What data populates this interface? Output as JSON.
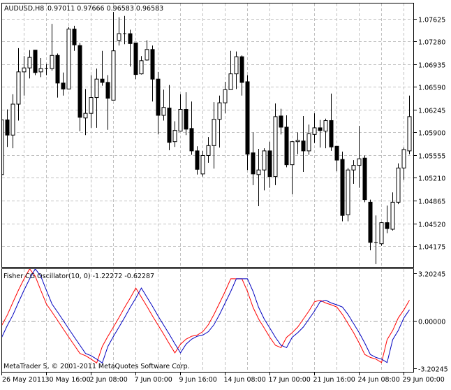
{
  "header": {
    "symbol": "AUDUSD,H8",
    "ohlc_readout": "0.97011 0.97666 0.96583 0.96583"
  },
  "indicator": {
    "label": "Fisher CG Oscillator(10, 0) -1.22272 -0.62287"
  },
  "copyright": "MetaTrader 5, © 2001-2011 MetaQuotes Software Corp.",
  "colors": {
    "background": "#ffffff",
    "grid": "#c0c0c0",
    "candle": "#000000",
    "fisher_line": "#ff0000",
    "trigger_line": "#0000c0"
  },
  "chart_data": [
    {
      "type": "candlestick",
      "timeframe": "H8",
      "grid": true,
      "ylim": [
        1.039,
        1.078
      ],
      "ytick_labels": [
        "1.07625",
        "1.07280",
        "1.06935",
        "1.06590",
        "1.06245",
        "1.05900",
        "1.05555",
        "1.05210",
        "1.04865",
        "1.04520",
        "1.04175"
      ],
      "ohlc": [
        [
          1.0526,
          1.0609,
          1.0526,
          1.0609
        ],
        [
          1.0609,
          1.0625,
          1.0568,
          1.0586
        ],
        [
          1.0586,
          1.0648,
          1.0566,
          1.0633
        ],
        [
          1.0633,
          1.0718,
          1.0608,
          1.0682
        ],
        [
          1.0682,
          1.0706,
          1.0646,
          1.0688
        ],
        [
          1.0688,
          1.0715,
          1.0672,
          1.0704
        ],
        [
          1.0715,
          1.0715,
          1.0677,
          1.0681
        ],
        [
          1.0682,
          1.0703,
          1.0674,
          1.0687
        ],
        [
          1.0687,
          1.0694,
          1.0677,
          1.0687
        ],
        [
          1.0687,
          1.0755,
          1.0684,
          1.0707
        ],
        [
          1.0707,
          1.071,
          1.0643,
          1.0665
        ],
        [
          1.0665,
          1.0681,
          1.0646,
          1.0656
        ],
        [
          1.0656,
          1.075,
          1.0656,
          1.0747
        ],
        [
          1.0747,
          1.0752,
          1.0714,
          1.0723
        ],
        [
          1.0722,
          1.0726,
          1.0592,
          1.0613
        ],
        [
          1.0612,
          1.0656,
          1.0586,
          1.0619
        ],
        [
          1.0619,
          1.0677,
          1.0597,
          1.0643
        ],
        [
          1.0643,
          1.0687,
          1.0597,
          1.0671
        ],
        [
          1.0671,
          1.0714,
          1.0661,
          1.0666
        ],
        [
          1.0666,
          1.0677,
          1.0594,
          1.0642
        ],
        [
          1.0639,
          1.0773,
          1.0639,
          1.0714
        ],
        [
          1.073,
          1.0765,
          1.0722,
          1.074
        ],
        [
          1.074,
          1.0767,
          1.0724,
          1.074
        ],
        [
          1.074,
          1.0746,
          1.069,
          1.0725
        ],
        [
          1.0726,
          1.0726,
          1.0671,
          1.0678
        ],
        [
          1.0679,
          1.0706,
          1.0678,
          1.0699
        ],
        [
          1.07,
          1.073,
          1.0699,
          1.0716
        ],
        [
          1.0716,
          1.0722,
          1.0637,
          1.0671
        ],
        [
          1.0671,
          1.0682,
          1.0587,
          1.0616
        ],
        [
          1.0616,
          1.0655,
          1.0608,
          1.0628
        ],
        [
          1.0627,
          1.0662,
          1.0563,
          1.0575
        ],
        [
          1.0576,
          1.0607,
          1.0568,
          1.0593
        ],
        [
          1.0592,
          1.0648,
          1.0592,
          1.0625
        ],
        [
          1.0625,
          1.0651,
          1.0586,
          1.0595
        ],
        [
          1.0596,
          1.0637,
          1.0556,
          1.0562
        ],
        [
          1.0562,
          1.0569,
          1.0526,
          1.0534
        ],
        [
          1.0527,
          1.0562,
          1.0523,
          1.0555
        ],
        [
          1.0555,
          1.0583,
          1.0544,
          1.057
        ],
        [
          1.057,
          1.0636,
          1.0535,
          1.061
        ],
        [
          1.061,
          1.0646,
          1.0567,
          1.0635
        ],
        [
          1.0635,
          1.0667,
          1.0619,
          1.0655
        ],
        [
          1.0655,
          1.0714,
          1.0655,
          1.0679
        ],
        [
          1.0679,
          1.0713,
          1.0656,
          1.0705
        ],
        [
          1.0705,
          1.0707,
          1.0646,
          1.0666
        ],
        [
          1.0667,
          1.0677,
          1.0533,
          1.0557
        ],
        [
          1.0559,
          1.059,
          1.051,
          1.0527
        ],
        [
          1.0526,
          1.0565,
          1.0478,
          1.0533
        ],
        [
          1.0533,
          1.0566,
          1.0502,
          1.0562
        ],
        [
          1.0562,
          1.0576,
          1.0506,
          1.0523
        ],
        [
          1.0523,
          1.0634,
          1.051,
          1.0614
        ],
        [
          1.0615,
          1.0626,
          1.0587,
          1.0598
        ],
        [
          1.0598,
          1.0616,
          1.0537,
          1.0541
        ],
        [
          1.0541,
          1.0577,
          1.0496,
          1.0576
        ],
        [
          1.0576,
          1.059,
          1.0557,
          1.0578
        ],
        [
          1.0577,
          1.0615,
          1.053,
          1.0562
        ],
        [
          1.0562,
          1.0602,
          1.0556,
          1.0588
        ],
        [
          1.0587,
          1.0619,
          1.0574,
          1.0597
        ],
        [
          1.0597,
          1.0609,
          1.0567,
          1.0593
        ],
        [
          1.0592,
          1.0611,
          1.0566,
          1.0608
        ],
        [
          1.0608,
          1.0649,
          1.0562,
          1.0568
        ],
        [
          1.0569,
          1.0569,
          1.0531,
          1.0548
        ],
        [
          1.0549,
          1.0561,
          1.0455,
          1.0464
        ],
        [
          1.0465,
          1.0536,
          1.0455,
          1.0533
        ],
        [
          1.0533,
          1.0548,
          1.0512,
          1.054
        ],
        [
          1.054,
          1.06,
          1.0506,
          1.055
        ],
        [
          1.0551,
          1.0555,
          1.0484,
          1.0488
        ],
        [
          1.0484,
          1.0488,
          1.0411,
          1.0423
        ],
        [
          1.0423,
          1.0464,
          1.039,
          1.0423
        ],
        [
          1.0421,
          1.0454,
          1.0418,
          1.0453
        ],
        [
          1.0453,
          1.0479,
          1.0437,
          1.0444
        ],
        [
          1.0443,
          1.0499,
          1.0441,
          1.0484
        ],
        [
          1.0484,
          1.0543,
          1.0481,
          1.0536
        ],
        [
          1.0536,
          1.0567,
          1.0518,
          1.0564
        ],
        [
          1.0562,
          1.0646,
          1.0557,
          1.0614
        ]
      ]
    },
    {
      "type": "line",
      "title": "Fisher CG Oscillator(10, 0)",
      "ylim": [
        -3.20245,
        3.20245
      ],
      "ytick_labels": [
        "3.20245",
        "0.00000",
        "-3.20245"
      ],
      "grid": true,
      "series": [
        {
          "color": "#ff0000",
          "values": [
            -0.31,
            0.39,
            1.25,
            2.07,
            2.83,
            3.5,
            3.0,
            2.05,
            1.13,
            0.59,
            0.03,
            -0.54,
            -1.1,
            -1.65,
            -2.2,
            -2.35,
            -2.58,
            -2.84,
            -1.73,
            -1.05,
            -0.42,
            0.22,
            0.9,
            1.53,
            2.21,
            1.59,
            0.97,
            0.32,
            -0.29,
            -0.91,
            -1.55,
            -2.16,
            -1.58,
            -1.24,
            -1.04,
            -0.96,
            -0.73,
            -0.26,
            0.43,
            1.2,
            1.98,
            2.83,
            2.83,
            2.83,
            1.98,
            0.9,
            0.12,
            -0.49,
            -1.11,
            -1.65,
            -1.81,
            -1.11,
            -0.8,
            -0.42,
            0.12,
            0.66,
            1.28,
            1.39,
            1.2,
            1.08,
            0.93,
            0.43,
            -0.19,
            -0.8,
            -1.5,
            -2.27,
            -2.47,
            -2.58,
            -2.81,
            -1.27,
            -0.65,
            0.2,
            0.74,
            1.39
          ]
        },
        {
          "color": "#0000c0",
          "values": [
            -1.11,
            -0.31,
            0.39,
            1.25,
            2.07,
            2.83,
            3.5,
            3.0,
            2.05,
            1.13,
            0.59,
            0.03,
            -0.54,
            -1.1,
            -1.65,
            -2.2,
            -2.35,
            -2.58,
            -2.84,
            -1.73,
            -1.05,
            -0.42,
            0.22,
            0.9,
            1.53,
            2.21,
            1.59,
            0.97,
            0.32,
            -0.29,
            -0.91,
            -1.55,
            -2.16,
            -1.58,
            -1.24,
            -1.04,
            -0.96,
            -0.73,
            -0.26,
            0.43,
            1.2,
            1.98,
            2.83,
            2.83,
            2.83,
            1.98,
            0.9,
            0.12,
            -0.49,
            -1.11,
            -1.65,
            -1.81,
            -1.11,
            -0.8,
            -0.42,
            0.12,
            0.66,
            1.28,
            1.39,
            1.2,
            1.08,
            0.93,
            0.43,
            -0.19,
            -0.8,
            -1.5,
            -2.27,
            -2.47,
            -2.58,
            -2.81,
            -1.27,
            -0.65,
            0.2,
            0.74
          ]
        }
      ]
    }
  ],
  "time_axis": {
    "labels": [
      "26 May 2011",
      "30 May 16:00",
      "2 Jun 08:00",
      "7 Jun 00:00",
      "9 Jun 16:00",
      "14 Jun 08:00",
      "17 Jun 00:00",
      "21 Jun 16:00",
      "24 Jun 08:00",
      "29 Jun 00:00"
    ]
  }
}
